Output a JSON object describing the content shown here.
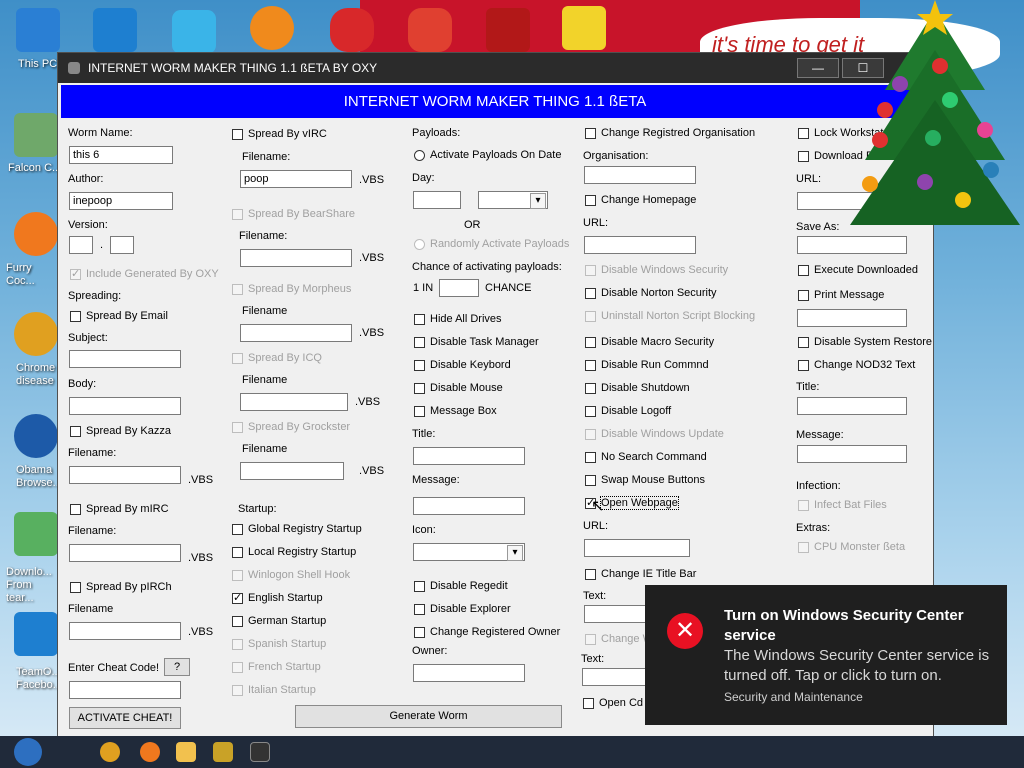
{
  "desktop": {
    "icons": [
      {
        "label": "This PC"
      },
      {
        "label": "Falcon C..."
      },
      {
        "label": "Furry Coc..."
      },
      {
        "label": "Chrome disease"
      },
      {
        "label": "Obama Browse..."
      },
      {
        "label": "Downlo... From tear..."
      },
      {
        "label": "TeamO... Facebo..."
      }
    ],
    "banner_text": "it's time to get it"
  },
  "window": {
    "title": "INTERNET WORM MAKER THING 1.1 ßETA BY OXY",
    "header": "INTERNET WORM MAKER THING 1.1 ßETA",
    "col1": {
      "worm_name_label": "Worm Name:",
      "worm_name_value": "this 6",
      "author_label": "Author:",
      "author_value": "inepoop",
      "version_label": "Version:",
      "version_dot": ".",
      "include_generated": "Include Generated By OXY",
      "spreading_label": "Spreading:",
      "spread_email": "Spread By Email",
      "subject_label": "Subject:",
      "body_label": "Body:",
      "spread_kazza": "Spread By Kazza",
      "filename1": "Filename:",
      "vbs1": ".VBS",
      "spread_mirc": "Spread By mIRC",
      "filename2": "Filename:",
      "vbs2": ".VBS",
      "spread_pirch": "Spread By pIRCh",
      "filename3": "Filename",
      "vbs3": ".VBS",
      "cheat_label": "Enter Cheat Code!",
      "cheat_help": "?",
      "activate_cheat": "ACTIVATE CHEAT!"
    },
    "col2": {
      "spread_virc": "Spread By vIRC",
      "filename1": "Filename:",
      "filename1_value": "poop",
      "vbs1": ".VBS",
      "spread_bearshare": "Spread By BearShare",
      "filename2": "Filename:",
      "vbs2": ".VBS",
      "spread_morpheus": "Spread By Morpheus",
      "filename3": "Filename",
      "vbs3": ".VBS",
      "spread_icq": "Spread By ICQ",
      "filename4": "Filename",
      "vbs4": ".VBS",
      "spread_grockster": "Spread By Grockster",
      "filename5": "Filename",
      "vbs5": ".VBS",
      "startup_label": "Startup:",
      "startups": [
        "Global Registry Startup",
        "Local Registry Startup",
        "Winlogon Shell Hook",
        "English Startup",
        "German Startup",
        "Spanish Startup",
        "French Startup",
        "Italian Startup"
      ],
      "generate": "Generate Worm"
    },
    "col3": {
      "payloads_label": "Payloads:",
      "activate_on_date": "Activate Payloads On Date",
      "day_label": "Day:",
      "or": "OR",
      "randomly_activate": "Randomly Activate Payloads",
      "chance_label": "Chance of activating payloads:",
      "one_in": "1 IN",
      "chance": "CHANCE",
      "checks": [
        "Hide All Drives",
        "Disable Task Manager",
        "Disable Keybord",
        "Disable Mouse",
        "Message Box"
      ],
      "title_label": "Title:",
      "message_label": "Message:",
      "icon_label": "Icon:",
      "checks2": [
        "Disable Regedit",
        "Disable Explorer",
        "Change Registered Owner"
      ],
      "owner_label": "Owner:"
    },
    "col4": {
      "change_org": "Change Registred Organisation",
      "org_label": "Organisation:",
      "change_home": "Change Homepage",
      "url_label": "URL:",
      "checks": [
        "Disable Windows Security",
        "Disable Norton Security",
        "Uninstall Norton Script Blocking",
        "Disable Macro Security",
        "Disable Run Commnd",
        "Disable Shutdown",
        "Disable Logoff",
        "Disable Windows Update",
        "No Search Command",
        "Swap Mouse Buttons",
        "Open Webpage"
      ],
      "url2_label": "URL:",
      "change_ie": "Change IE Title Bar",
      "text_label": "Text:",
      "change_w": "Change W",
      "text2_label": "Text:",
      "open_cd": "Open Cd"
    },
    "col5": {
      "lock_ws": "Lock Workstat",
      "download_file": "Download File",
      "url_label": "URL:",
      "save_as_label": "Save As:",
      "execute_downloaded": "Execute Downloaded",
      "print_message": "Print Message",
      "disable_restore": "Disable System Restore",
      "change_nod32": "Change NOD32 Text",
      "title_label": "Title:",
      "message_label": "Message:",
      "infection_label": "Infection:",
      "infect_bat": "Infect Bat Files",
      "extras_label": "Extras:",
      "cpu_monster": "CPU Monster ßeta"
    }
  },
  "toast": {
    "title": "Turn on Windows Security Center service",
    "body": "The Windows Security Center service is turned off. Tap or click to turn on.",
    "source": "Security and Maintenance"
  },
  "colors": {
    "header_blue": "#0000ff",
    "toast_bg": "#1f1f1f",
    "error_red": "#e81123"
  }
}
